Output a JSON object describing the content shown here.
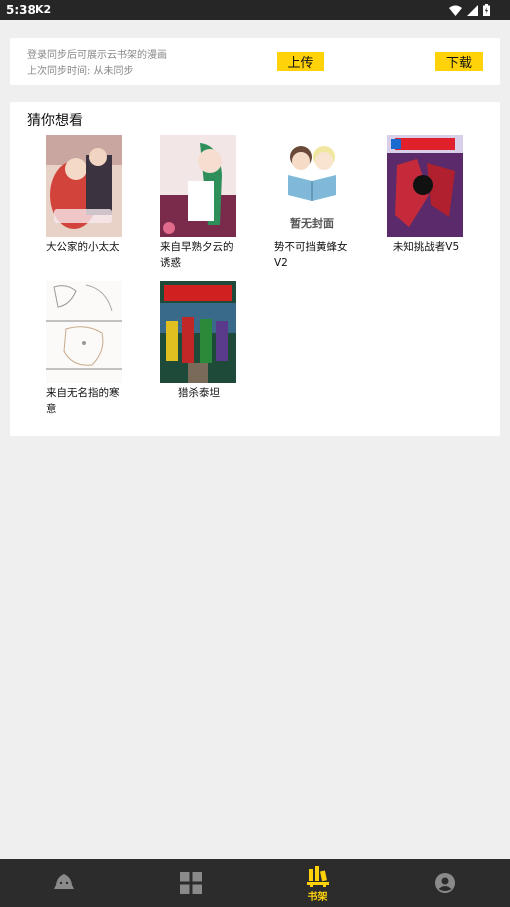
{
  "status": {
    "time": "5:38",
    "carrier_badge": "K2"
  },
  "sync": {
    "hint": "登录同步后可展示云书架的漫画",
    "last_sync": "上次同步时间: 从未同步",
    "upload_label": "上传",
    "download_label": "下载"
  },
  "recommend": {
    "title": "猜你想看",
    "books": [
      {
        "name": "大公家的小太太"
      },
      {
        "name": "来自早熟夕云的诱惑"
      },
      {
        "name": "势不可挡黄蜂女V2",
        "cover_text": "暂无封面"
      },
      {
        "name": "未知挑战者V5"
      },
      {
        "name": "来自无名指的寒意"
      },
      {
        "name": "猎杀泰坦"
      }
    ]
  },
  "bottom_nav": {
    "items": [
      {
        "icon": "home-mascot-icon"
      },
      {
        "icon": "category-grid-icon"
      },
      {
        "icon": "bookshelf-icon",
        "label": "书架",
        "active": true
      },
      {
        "icon": "account-icon"
      }
    ]
  },
  "colors": {
    "accent": "#ffd20a",
    "bar": "#2c2c2c",
    "background": "#efefef"
  }
}
